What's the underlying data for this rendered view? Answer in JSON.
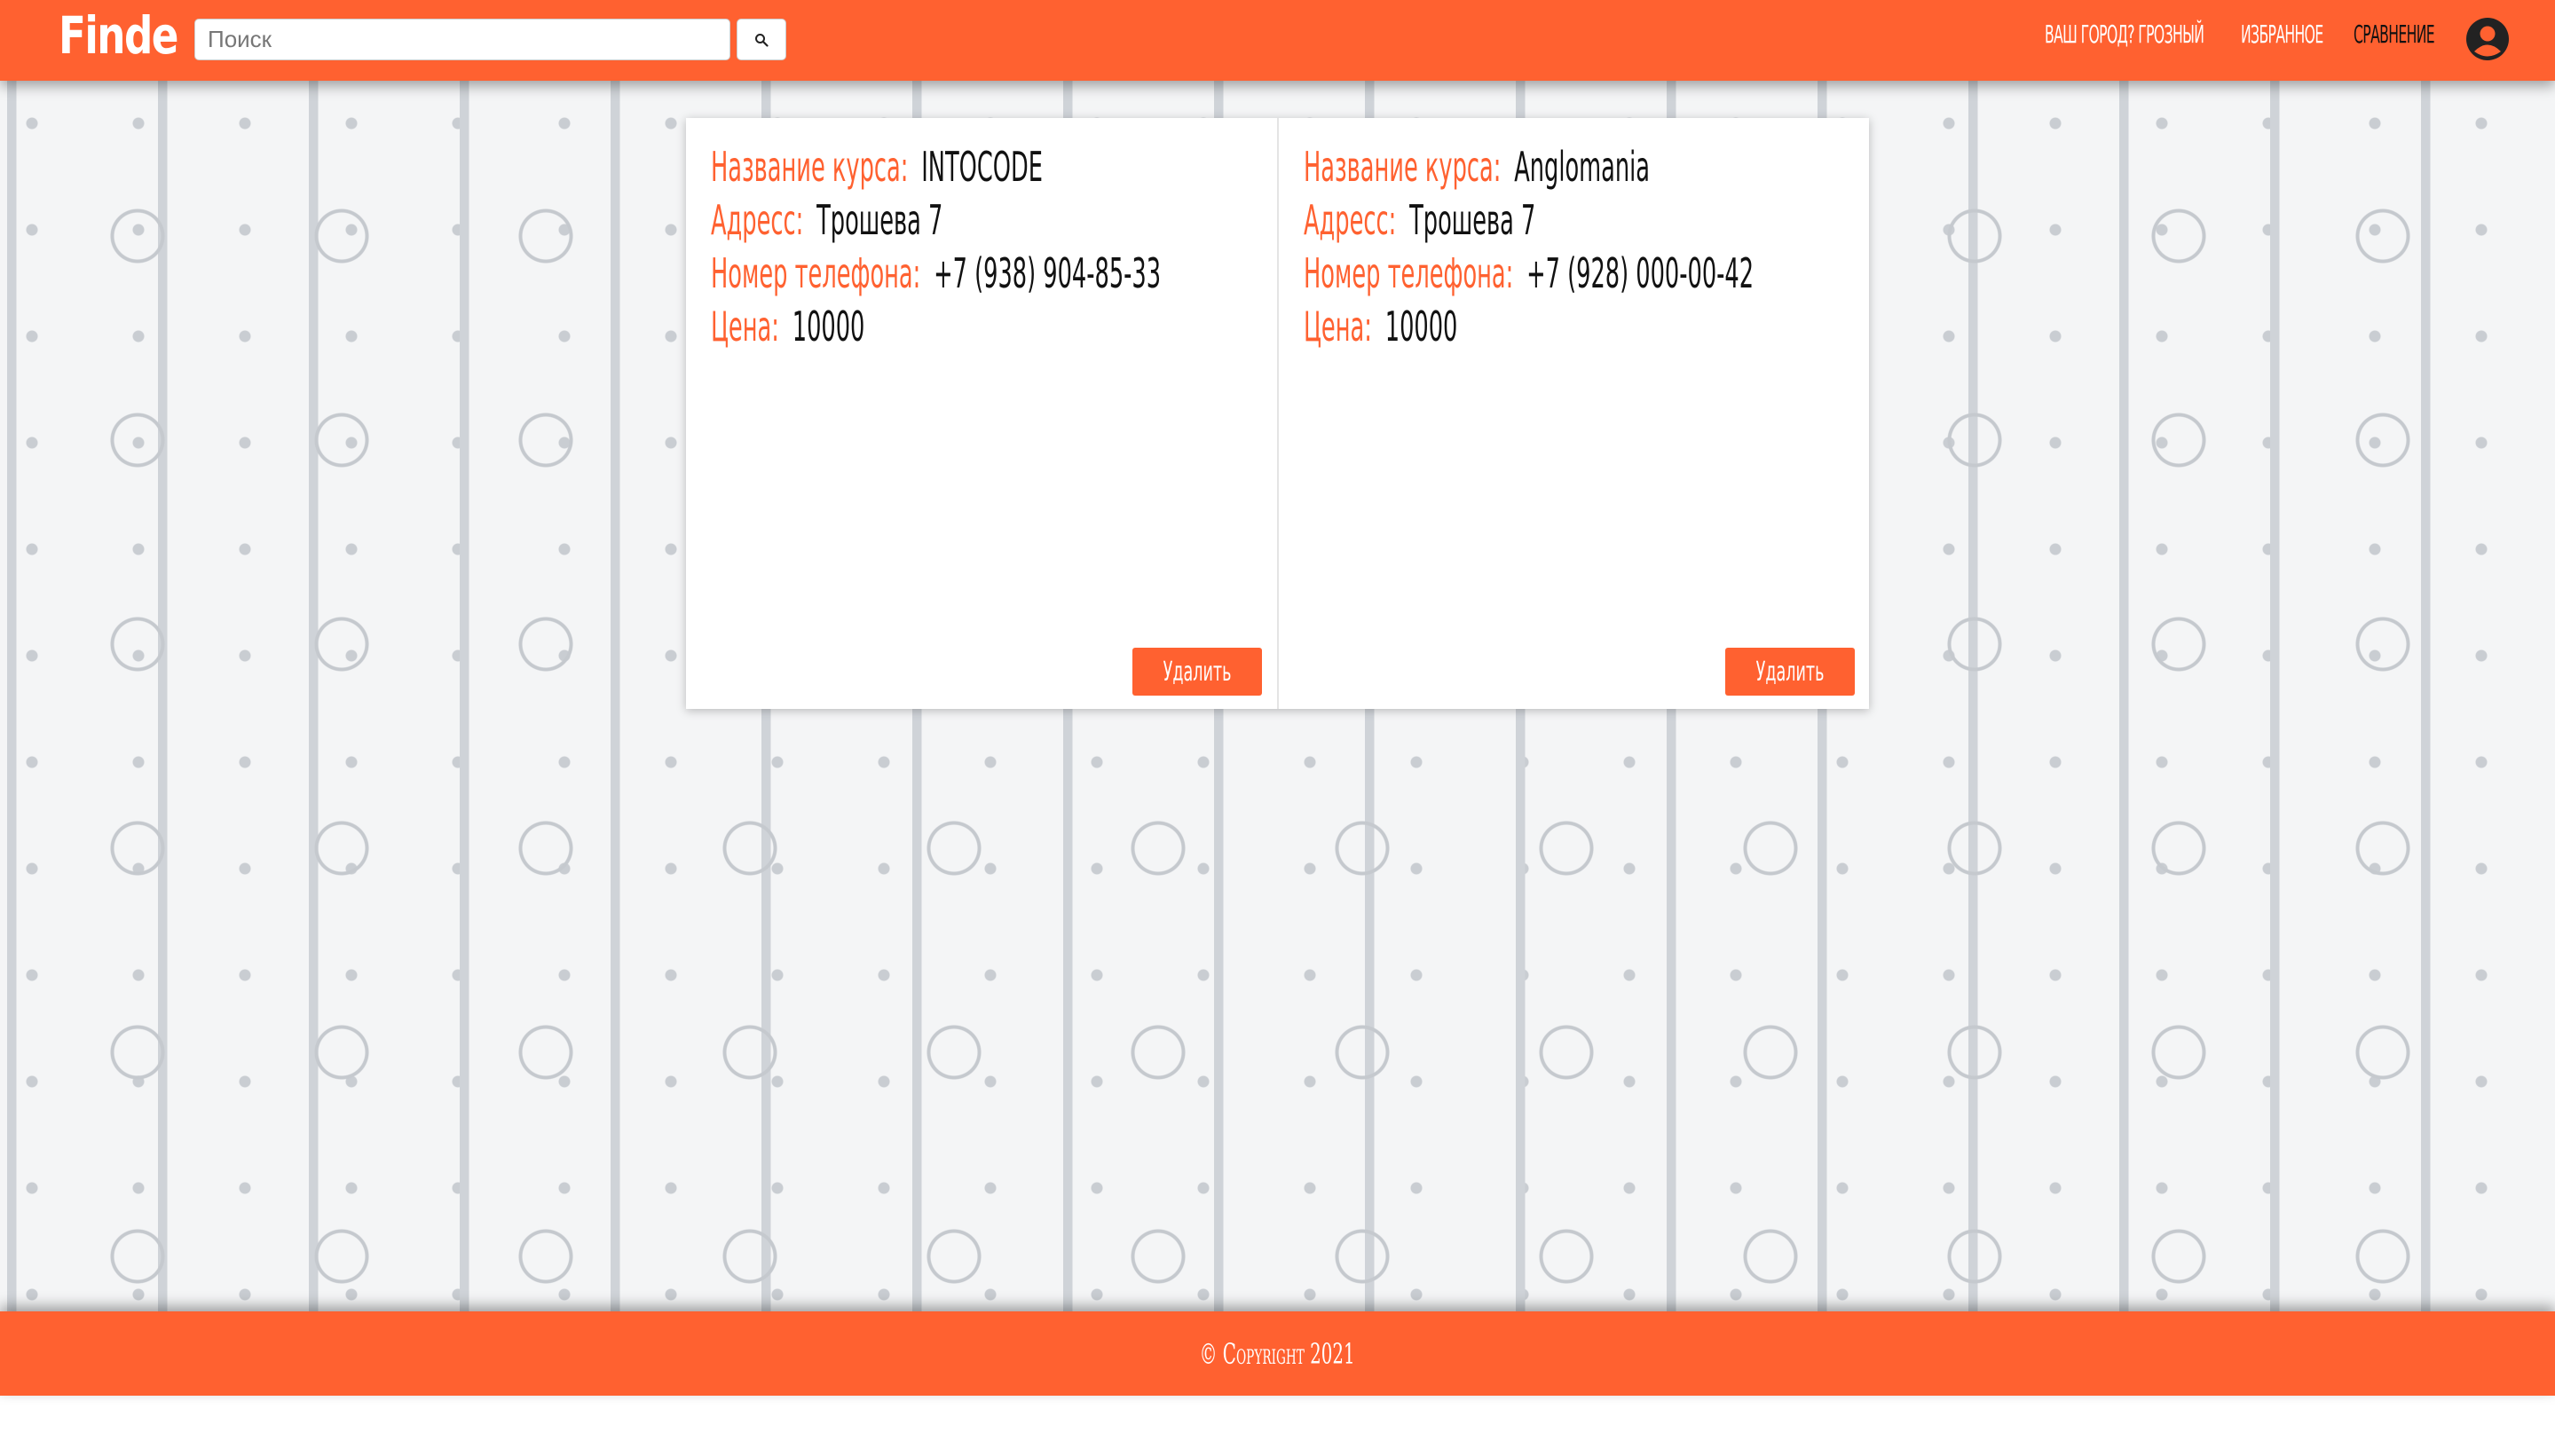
{
  "header": {
    "logo": "Finde",
    "search": {
      "placeholder": "Поиск",
      "value": ""
    },
    "nav": {
      "city": "ВАШ ГОРОД? ГРОЗНЫЙ",
      "favorites": "ИЗБРАННОЕ",
      "compare": "СРАВНЕНИЕ"
    },
    "icons": {
      "search": "search-icon",
      "user": "user-circle-icon"
    }
  },
  "courses": [
    {
      "name_label": "Название курса:",
      "name": "INTOCODE",
      "address_label": "Адресс:",
      "address": "Трошева 7",
      "phone_label": "Номер телефона:",
      "phone": "+7 (938) 904-85-33",
      "price_label": "Цена:",
      "price": "10000",
      "delete_label": "Удалить"
    },
    {
      "name_label": "Название курса:",
      "name": "Anglomania",
      "address_label": "Адресс:",
      "address": "Трошева 7",
      "phone_label": "Номер телефона:",
      "phone": "+7 (928) 000-00-42",
      "price_label": "Цена:",
      "price": "10000",
      "delete_label": "Удалить"
    }
  ],
  "footer": {
    "copyright": "© Copyright 2021"
  },
  "colors": {
    "accent": "#ff6130",
    "active_nav": "#111111",
    "card_bg": "#ffffff"
  }
}
